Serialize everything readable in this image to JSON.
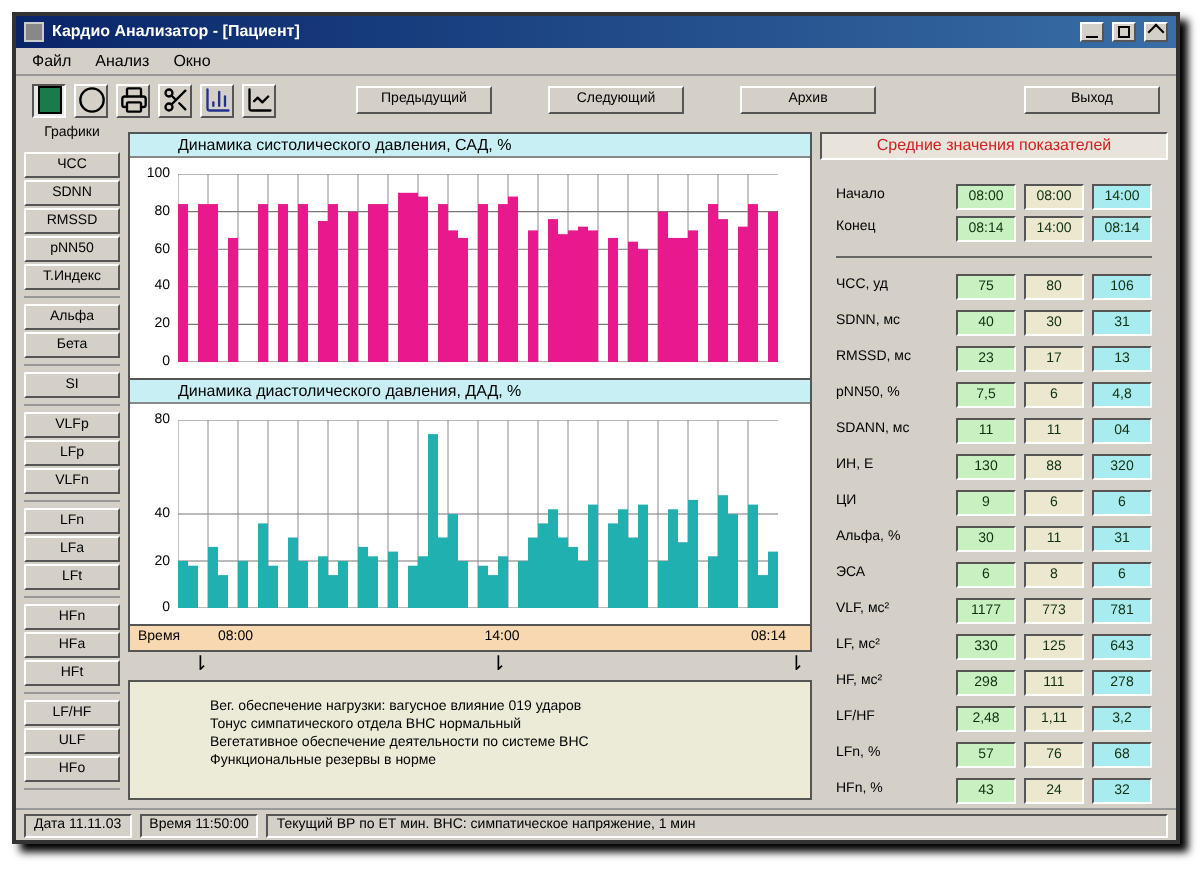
{
  "window": {
    "title": "Кардио Анализатор - [Пациент]"
  },
  "menu": [
    "Файл",
    "Анализ",
    "Окно"
  ],
  "toolbar": {
    "icons": [
      {
        "kind": "panel",
        "selected": true
      },
      {
        "kind": "circle",
        "selected": false
      },
      {
        "kind": "printer",
        "selected": false
      },
      {
        "kind": "scissors",
        "selected": false
      },
      {
        "kind": "bars",
        "selected": false
      },
      {
        "kind": "line",
        "selected": false
      }
    ],
    "buttons": [
      "Предыдущий",
      "Следующий",
      "Архив",
      "Выход"
    ]
  },
  "sidebar": {
    "title": "Графики",
    "groups": [
      {
        "items": [
          {
            "label": "ЧСС",
            "selected": false
          },
          {
            "label": "SDNN",
            "selected": false
          },
          {
            "label": "RMSSD",
            "selected": false
          },
          {
            "label": "pNN50",
            "selected": false
          },
          {
            "label": "Т.Индекс",
            "selected": false
          }
        ]
      },
      {
        "items": [
          {
            "label": "Альфа",
            "selected": false
          },
          {
            "label": "Бета",
            "selected": false
          }
        ]
      },
      {
        "items": [
          {
            "label": "SI",
            "selected": false
          }
        ]
      },
      {
        "items": [
          {
            "label": "VLFp",
            "selected": false
          },
          {
            "label": "LFp",
            "selected": false
          },
          {
            "label": "VLFn",
            "selected": false
          }
        ]
      },
      {
        "items": [
          {
            "label": "LFn",
            "selected": false
          },
          {
            "label": "LFa",
            "selected": false
          },
          {
            "label": "LFt",
            "selected": false
          }
        ]
      },
      {
        "items": [
          {
            "label": "HFn",
            "selected": false
          },
          {
            "label": "HFa",
            "selected": false
          },
          {
            "label": "HFt",
            "selected": false
          }
        ]
      },
      {
        "items": [
          {
            "label": "LF/HF",
            "selected": false
          },
          {
            "label": "ULF",
            "selected": false
          },
          {
            "label": "HFo",
            "selected": false
          }
        ]
      }
    ]
  },
  "charts": [
    {
      "title": "Динамика систолического давления, САД, %",
      "chart_data": {
        "type": "bar",
        "grid": true,
        "yticks": [
          0,
          20,
          40,
          60,
          80,
          100
        ],
        "ylim": [
          0,
          100
        ],
        "series": [
          {
            "color": "#e8198c",
            "values": [
              84,
              0,
              84,
              84,
              0,
              66,
              0,
              0,
              84,
              0,
              84,
              0,
              84,
              0,
              75,
              84,
              0,
              80,
              0,
              84,
              84,
              0,
              90,
              90,
              88,
              0,
              84,
              70,
              66,
              0,
              84,
              0,
              84,
              88,
              0,
              70,
              0,
              76,
              68,
              70,
              72,
              70,
              0,
              66,
              0,
              64,
              60,
              0,
              80,
              66,
              66,
              70,
              0,
              84,
              76,
              0,
              72,
              84,
              0,
              80
            ]
          }
        ]
      }
    },
    {
      "title": "Динамика диастолического давления, ДАД, %",
      "chart_data": {
        "type": "bar",
        "grid": true,
        "yticks": [
          0,
          20,
          40,
          80
        ],
        "ylim": [
          0,
          80
        ],
        "series": [
          {
            "color": "#20b0b0",
            "values": [
              20,
              18,
              0,
              26,
              14,
              0,
              20,
              0,
              36,
              18,
              0,
              30,
              20,
              0,
              22,
              14,
              20,
              0,
              26,
              22,
              0,
              24,
              0,
              18,
              22,
              74,
              30,
              40,
              20,
              0,
              18,
              14,
              22,
              0,
              20,
              30,
              36,
              42,
              30,
              26,
              20,
              44,
              0,
              36,
              42,
              30,
              44,
              0,
              20,
              42,
              28,
              46,
              0,
              22,
              48,
              40,
              0,
              44,
              14,
              24
            ]
          }
        ]
      }
    }
  ],
  "time_bar": {
    "label": "Время",
    "ticks": [
      "08:00",
      "14:00",
      "08:14"
    ]
  },
  "markers": [
    "⇂",
    "⇂",
    "⇂"
  ],
  "notes": [
    "Вег. обеспечение нагрузки: вагусное влияние 019 ударов",
    "Тонус симпатического отдела ВНС нормальный",
    "Вегетативное обеспечение деятельности по системе ВНС",
    "Функциональные резервы в норме"
  ],
  "stats": {
    "title": "Средние значения показателей",
    "columns": [
      {
        "color": "#c8f0c0"
      },
      {
        "color": "#ece8d0"
      },
      {
        "color": "#a8ecf0"
      }
    ],
    "times": [
      {
        "label": "Начало",
        "values": [
          "08:00",
          "08:00",
          "14:00"
        ]
      },
      {
        "label": "Конец",
        "values": [
          "08:14",
          "14:00",
          "08:14"
        ]
      }
    ],
    "rows": [
      {
        "label": "ЧСС, уд",
        "values": [
          "75",
          "80",
          "106"
        ]
      },
      {
        "label": "SDNN, мс",
        "values": [
          "40",
          "30",
          "31"
        ]
      },
      {
        "label": "RMSSD, мс",
        "values": [
          "23",
          "17",
          "13"
        ]
      },
      {
        "label": "pNN50, %",
        "values": [
          "7,5",
          "6",
          "4,8"
        ]
      },
      {
        "label": "SDANN, мс",
        "values": [
          "11",
          "11",
          "04"
        ]
      },
      {
        "label": "ИН, Е",
        "values": [
          "130",
          "88",
          "320"
        ]
      },
      {
        "label": "ЦИ",
        "values": [
          "9",
          "6",
          "6"
        ]
      },
      {
        "label": "Альфа, %",
        "values": [
          "30",
          "11",
          "31"
        ]
      },
      {
        "label": "ЭСА",
        "values": [
          "6",
          "8",
          "6"
        ]
      },
      {
        "label": "VLF, мс²",
        "values": [
          "1177",
          "773",
          "781"
        ]
      },
      {
        "label": "LF, мс²",
        "values": [
          "330",
          "125",
          "643"
        ]
      },
      {
        "label": "HF, мс²",
        "values": [
          "298",
          "111",
          "278"
        ]
      },
      {
        "label": "LF/HF",
        "values": [
          "2,48",
          "1,11",
          "3,2"
        ]
      },
      {
        "label": "LFn, %",
        "values": [
          "57",
          "76",
          "68"
        ]
      },
      {
        "label": "HFn, %",
        "values": [
          "43",
          "24",
          "32"
        ]
      }
    ]
  },
  "status_bar": [
    "Дата 11.11.03",
    "Время 11:50:00",
    "Текущий ВР по ЕТ мин. ВНС: симпатическое напряжение, 1 мин"
  ]
}
